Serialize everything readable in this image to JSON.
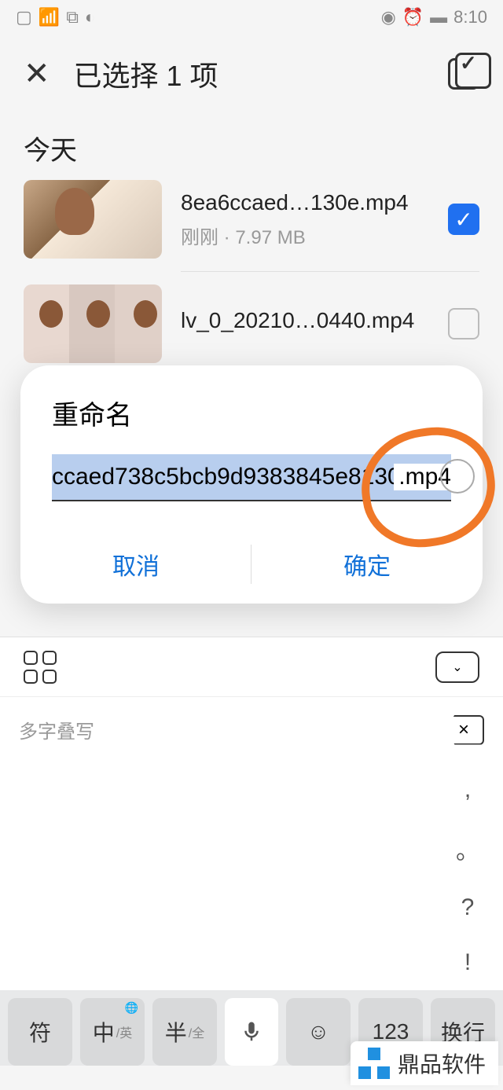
{
  "status": {
    "time": "8:10"
  },
  "header": {
    "title": "已选择 1 项"
  },
  "section": "今天",
  "files": [
    {
      "name": "8ea6ccaed…130e.mp4",
      "meta": "刚刚 · 7.97 MB",
      "checked": true
    },
    {
      "name": "lv_0_20210…0440.mp4",
      "meta": "",
      "checked": false
    }
  ],
  "dialog": {
    "title": "重命名",
    "value": "ccaed738c5bcb9d9383845e8130e",
    "ext": ".mp4",
    "cancel": "取消",
    "confirm": "确定"
  },
  "candidate": "多字叠写",
  "side_keys": [
    ",",
    "。",
    "?",
    "!"
  ],
  "bottom": {
    "k1": "符",
    "k2": "中",
    "k2sub": "/英",
    "k3": "半",
    "k3sub": "/全",
    "k6": "123",
    "k7": "换行"
  },
  "watermark": "鼎品软件"
}
